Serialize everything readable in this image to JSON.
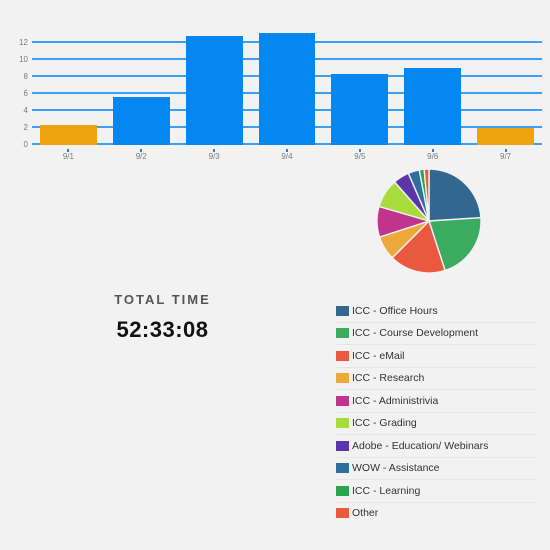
{
  "total_time": {
    "label": "TOTAL TIME",
    "value": "52:33:08"
  },
  "chart_data": [
    {
      "type": "bar",
      "title": "",
      "xlabel": "",
      "ylabel": "",
      "categories": [
        "9/1",
        "9/2",
        "9/3",
        "9/4",
        "9/5",
        "9/6",
        "9/7"
      ],
      "values": [
        2.3,
        5.6,
        12.8,
        13.2,
        8.3,
        9.1,
        2.0
      ],
      "colors": [
        "#eda30c",
        "#0587f2",
        "#0587f2",
        "#0587f2",
        "#0587f2",
        "#0587f2",
        "#eda30c"
      ],
      "ylim": [
        0,
        13.8
      ],
      "yticks": [
        0,
        2,
        4,
        6,
        8,
        10,
        12
      ],
      "ytick_labels": [
        "0",
        "2",
        "4",
        "6",
        "8",
        "10",
        "12"
      ],
      "grid": true,
      "grid_color": "#3ba0f5",
      "legend": "none"
    },
    {
      "type": "pie",
      "title": "",
      "legend_position": "bottom",
      "start_angle": -90,
      "labels": [
        "ICC - Office Hours",
        "ICC - Course Development",
        "ICC - eMail",
        "ICC - Research",
        "ICC - Administrivia",
        "ICC - Grading",
        "Adobe - Education/ Webinars",
        "WOW - Assistance",
        "ICC - Learning",
        "Other"
      ],
      "values": [
        24.0,
        21.0,
        17.5,
        7.5,
        9.5,
        9.0,
        5.0,
        3.5,
        1.5,
        1.5
      ],
      "colors": [
        "#33678f",
        "#3aab5f",
        "#e8593f",
        "#eda83a",
        "#c0358b",
        "#a8dc3c",
        "#5b36ab",
        "#2f6f9e",
        "#2aa44f",
        "#ea5a3d"
      ]
    }
  ]
}
